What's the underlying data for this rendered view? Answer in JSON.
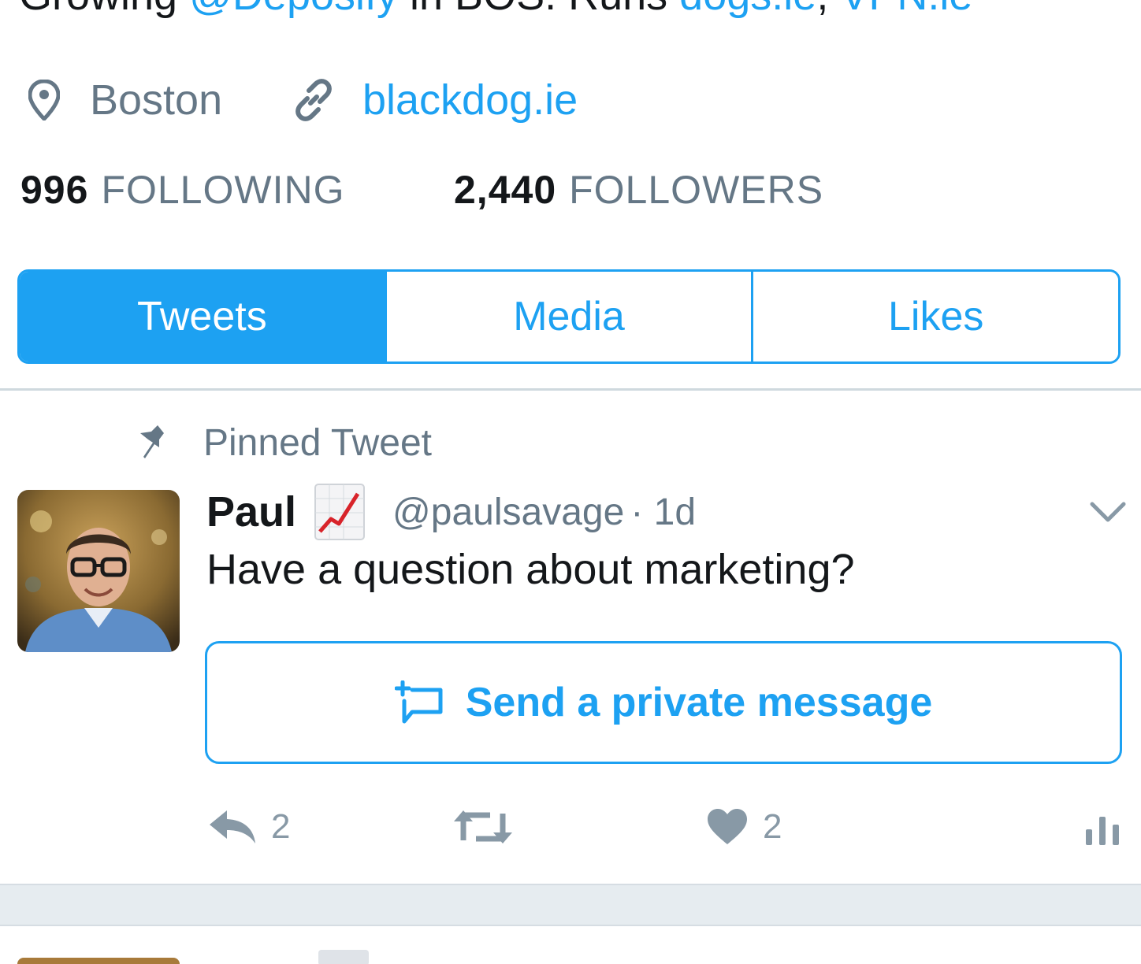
{
  "profile": {
    "bio_parts": [
      "Growing ",
      "@Deposify",
      " in BOS. Runs ",
      "dogs.ie",
      ", ",
      "VPN.ie"
    ],
    "location": "Boston",
    "website": "blackdog.ie",
    "following_count": "996",
    "following_label": "FOLLOWING",
    "followers_count": "2,440",
    "followers_label": "FOLLOWERS"
  },
  "tabs": [
    {
      "label": "Tweets",
      "active": true
    },
    {
      "label": "Media",
      "active": false
    },
    {
      "label": "Likes",
      "active": false
    }
  ],
  "pinned_tweet": {
    "pinned_label": "Pinned Tweet",
    "author_name": "Paul",
    "author_handle": "@paulsavage",
    "time": "· 1d",
    "text": "Have a question about marketing?",
    "dm_button_label": "Send a private message",
    "reply_count": "2",
    "like_count": "2"
  },
  "colors": {
    "accent": "#1da1f2",
    "secondary_text": "#657786",
    "action_gray": "#8899a6",
    "primary_text": "#14171a"
  },
  "icons": {
    "location": "location-pin-icon",
    "website": "link-icon",
    "pinned": "pin-icon",
    "dm": "direct-message-icon",
    "reply": "reply-icon",
    "retweet": "retweet-icon",
    "like": "heart-icon",
    "analytics": "analytics-icon",
    "menu": "chevron-down-icon",
    "emoji": "chart-increasing-emoji"
  }
}
